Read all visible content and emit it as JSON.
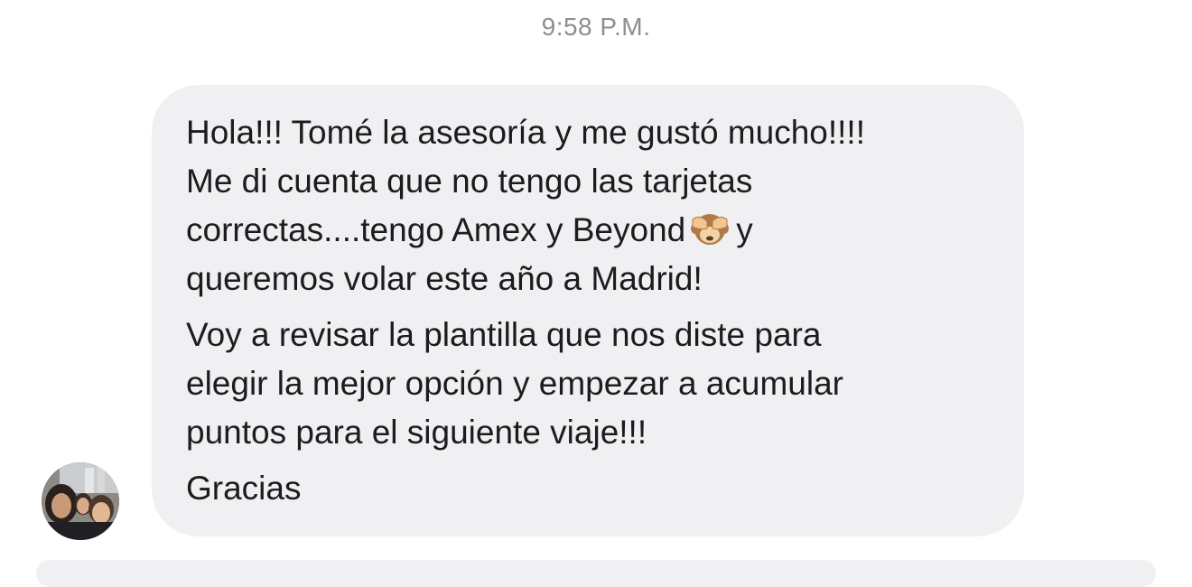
{
  "timestamp": "9:58 P.M.",
  "message": {
    "lines": [
      "Hola!!! Tomé la asesoría y me gustó mucho!!!!",
      "Me di cuenta que no tengo las tarjetas",
      "correctas....tengo Amex y Beyond",
      "y",
      "queremos volar este año a Madrid!",
      "Voy a revisar la plantilla que nos diste para",
      "elegir la mejor opción y empezar a acumular",
      "puntos para el siguiente viaje!!!",
      "Gracias"
    ],
    "emoji": "see-no-evil-monkey-icon"
  },
  "sender": {
    "avatar": "profile-photo"
  },
  "colors": {
    "bubble": "#f0f0f2",
    "text": "#1c1c1e",
    "timestamp": "#8e8e93"
  }
}
